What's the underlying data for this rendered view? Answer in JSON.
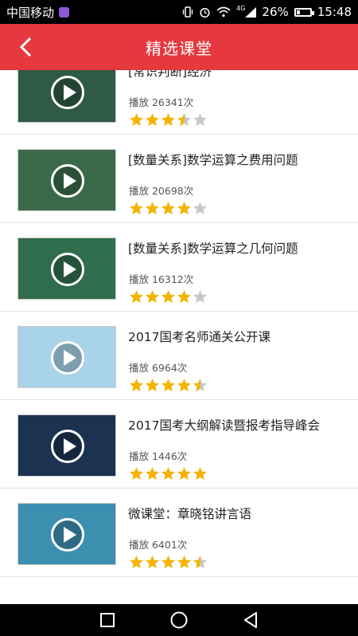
{
  "status": {
    "carrier": "中国移动",
    "network": "4G",
    "battery": "26%",
    "battery_level": 0.26,
    "time": "15:48"
  },
  "header": {
    "title": "精选课堂",
    "back_icon": "chevron-left-icon"
  },
  "courses": [
    {
      "title": "[常识判断]经济",
      "plays": "播放 26341次",
      "rating": 3.5,
      "thumb_bg": "#2e5a46"
    },
    {
      "title": "[数量关系]数学运算之费用问题",
      "plays": "播放 20698次",
      "rating": 4,
      "thumb_bg": "#3a6a4a"
    },
    {
      "title": "[数量关系]数学运算之几何问题",
      "plays": "播放 16312次",
      "rating": 4,
      "thumb_bg": "#2f6d4c"
    },
    {
      "title": "2017国考名师通关公开课",
      "plays": "播放 6964次",
      "rating": 4.5,
      "thumb_bg": "#a9d3e8"
    },
    {
      "title": "2017国考大纲解读暨报考指导峰会",
      "plays": "播放 1446次",
      "rating": 5,
      "thumb_bg": "#1b3350"
    },
    {
      "title": "微课堂：章晓铭讲言语",
      "plays": "播放 6401次",
      "rating": 4.5,
      "thumb_bg": "#3d8fb0"
    }
  ],
  "colors": {
    "accent": "#e5383f",
    "star_on": "#f4b400",
    "star_off": "#c8c8c8"
  },
  "navbar": {
    "buttons": [
      "recent-apps-icon",
      "home-icon",
      "back-icon"
    ]
  }
}
